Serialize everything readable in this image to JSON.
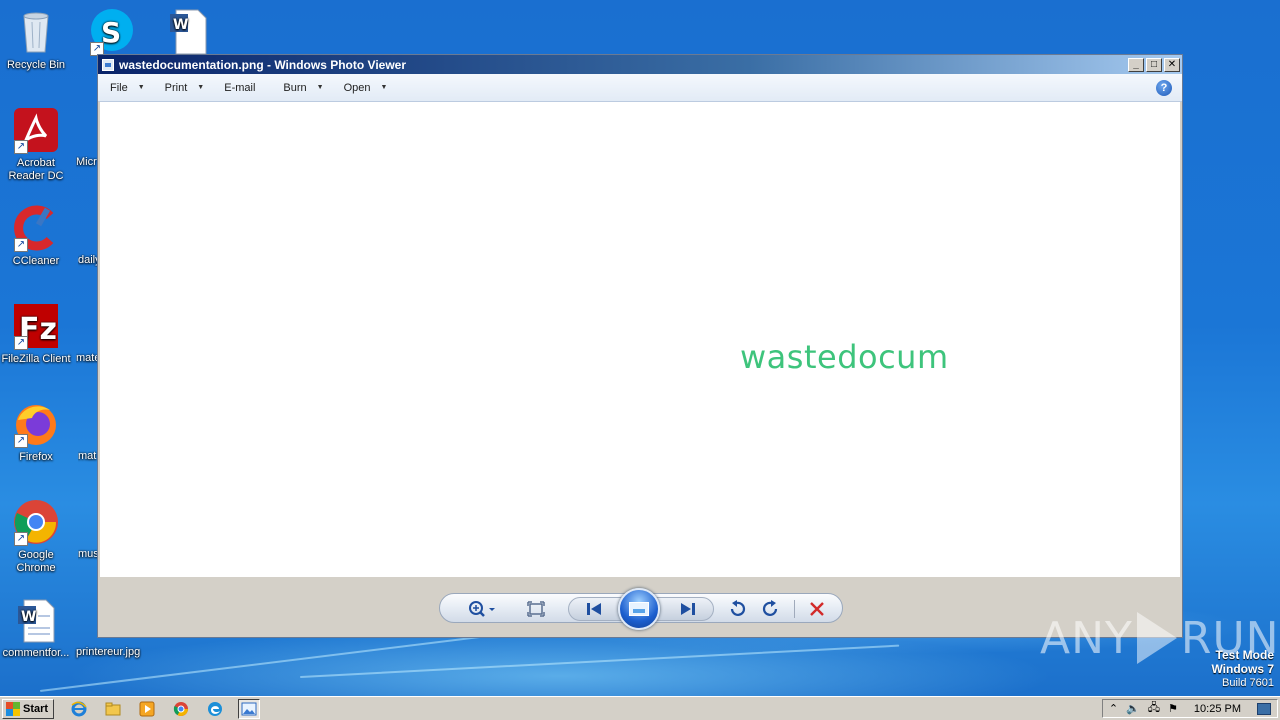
{
  "desktop": {
    "icons": [
      {
        "label": "Recycle Bin",
        "icon": "recycle-bin-icon"
      },
      {
        "label": "Acrobat Reader DC",
        "icon": "acrobat-icon"
      },
      {
        "label": "CCleaner",
        "icon": "ccleaner-icon"
      },
      {
        "label": "FileZilla Client",
        "icon": "filezilla-icon"
      },
      {
        "label": "Firefox",
        "icon": "firefox-icon"
      },
      {
        "label": "Google Chrome",
        "icon": "chrome-icon"
      },
      {
        "label": "commentfor...",
        "icon": "word-doc-icon"
      }
    ],
    "icons_col2": [
      {
        "label": "Micr",
        "icon": "edge-icon"
      },
      {
        "label": "daily",
        "icon": "file-icon"
      },
      {
        "label": "mate",
        "icon": "file-icon"
      },
      {
        "label": "mat",
        "icon": "file-icon"
      },
      {
        "label": "mus",
        "icon": "file-icon"
      },
      {
        "label": "printereur.jpg",
        "icon": "image-file-icon"
      }
    ]
  },
  "window": {
    "title": "wastedocumentation.png - Windows Photo Viewer",
    "menus": [
      {
        "label": "File",
        "has_dropdown": true
      },
      {
        "label": "Print",
        "has_dropdown": true
      },
      {
        "label": "E-mail",
        "has_dropdown": false
      },
      {
        "label": "Burn",
        "has_dropdown": true
      },
      {
        "label": "Open",
        "has_dropdown": true
      }
    ],
    "help_label": "?",
    "image_text": "wastedocum",
    "controls": [
      "zoom",
      "actual-size",
      "previous",
      "slideshow",
      "next",
      "rotate-counterclockwise",
      "rotate-clockwise",
      "delete"
    ]
  },
  "watermark": {
    "left": "ANY",
    "right": "RUN"
  },
  "system": {
    "mode": "Test Mode",
    "os": "Windows 7",
    "build": "Build 7601"
  },
  "taskbar": {
    "start_label": "Start",
    "clock": "10:25 PM"
  },
  "colors": {
    "image_text": "#3ec47c",
    "title_start": "#0a246a",
    "title_end": "#a6caf0"
  }
}
